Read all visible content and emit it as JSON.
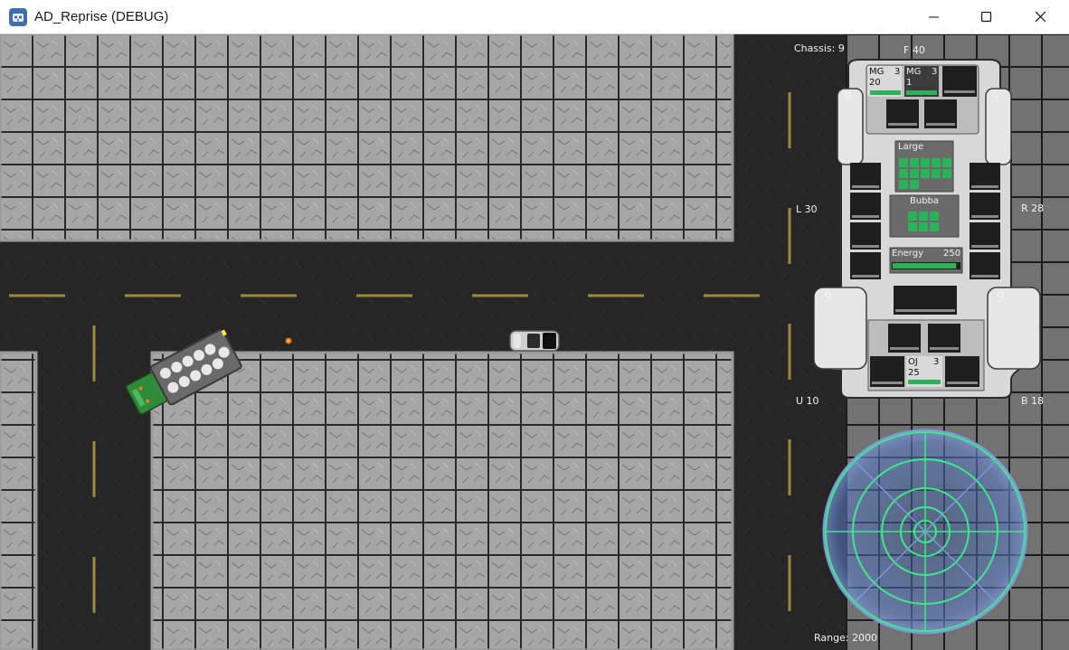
{
  "window": {
    "title": "AD_Reprise (DEBUG)",
    "icon": "godot-icon",
    "controls": [
      "minimize-icon",
      "maximize-icon",
      "close-icon"
    ]
  },
  "hud": {
    "chassis_label": "Chassis: 9",
    "armor": {
      "front": "F  40",
      "left": "L  30",
      "right": "R  28",
      "under": "U  10",
      "back": "B  18"
    },
    "tire_values": [
      "9",
      "9",
      "9",
      "9"
    ],
    "front_slots": [
      {
        "name": "MG",
        "ammo": "3",
        "count": "20"
      },
      {
        "name": "MG",
        "ammo": "3",
        "count": "1"
      }
    ],
    "large_label": "Large",
    "driver_label": "Bubba",
    "energy": {
      "label": "Energy",
      "value": "250",
      "fill": 0.95
    },
    "rear_slot": {
      "name": "OJ",
      "ammo": "3",
      "count": "25"
    },
    "range_label": "Range: 2000"
  },
  "colors": {
    "road": "#262626",
    "lane_marking": "#9a8a3a",
    "sidewalk": "#8c8c8c",
    "slot_green": "#2bb35a",
    "radar_ring": "#3ee88a",
    "radar_fill": "#4a6db0"
  }
}
